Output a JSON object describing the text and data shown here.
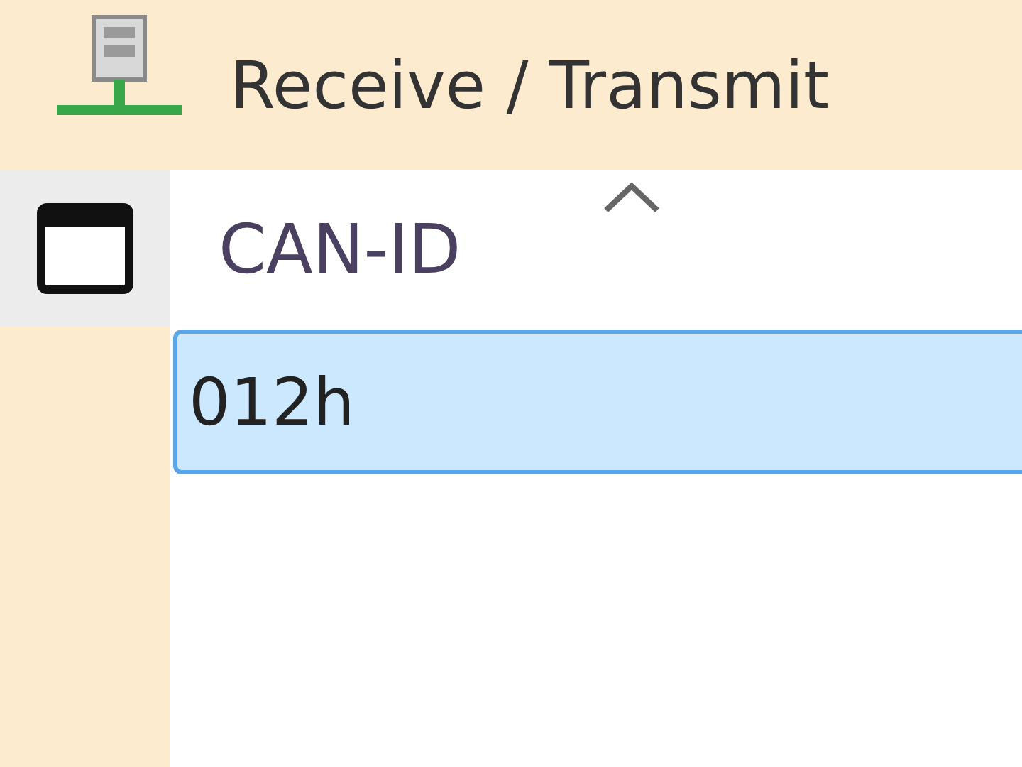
{
  "panel": {
    "title": "Receive / Transmit"
  },
  "table": {
    "columns": [
      {
        "label": "CAN-ID",
        "sorted_ascending": true
      }
    ],
    "rows": [
      {
        "cells": [
          "012h"
        ],
        "selected": true
      }
    ]
  }
}
